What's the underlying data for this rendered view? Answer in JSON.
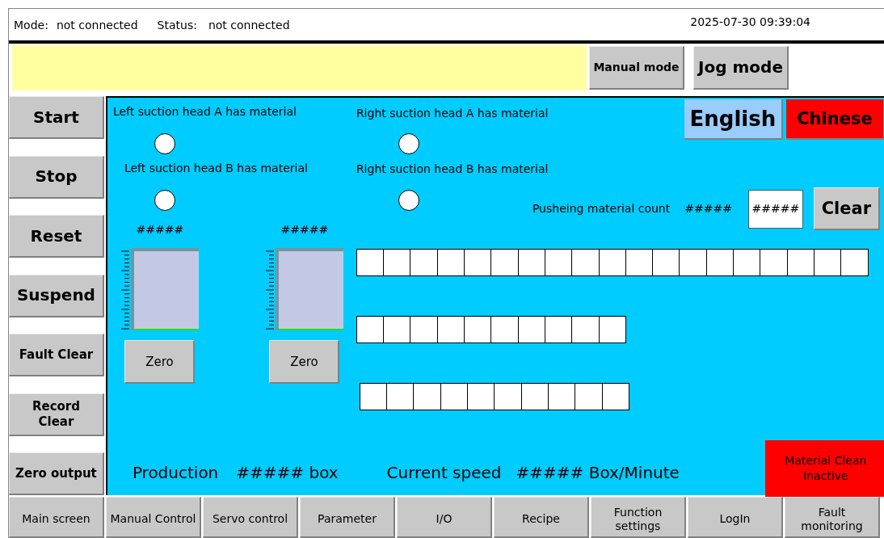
{
  "status_bar": {
    "mode_label": "Mode:",
    "mode_value": "not connected",
    "status_label": "Status:",
    "status_value": "not connected",
    "datetime": "2025-07-30 09:39:04"
  },
  "mode_buttons": [
    "Manual mode",
    "Jog mode"
  ],
  "side_buttons": [
    "Start",
    "Stop",
    "Reset",
    "Suspend",
    "Fault Clear",
    "Record\nClear",
    "Zero output"
  ],
  "lamps": [
    {
      "label": "Left suction head A has material",
      "on": false
    },
    {
      "label": "Left suction head B has material",
      "on": false
    },
    {
      "label": "Right suction head A has material",
      "on": false
    },
    {
      "label": "Right suction head B has material",
      "on": false
    }
  ],
  "language_buttons": [
    {
      "label": "English",
      "color": "#99ccff"
    },
    {
      "label": "Chinese",
      "color": "#ff0000"
    }
  ],
  "push_count": {
    "label": "Pusheing material count",
    "value": "#####",
    "input": "#####",
    "button": "Clear"
  },
  "gauges": [
    {
      "reading": "#####",
      "level": 0,
      "button": "Zero"
    },
    {
      "reading": "#####",
      "level": 0,
      "button": "Zero"
    }
  ],
  "slot_rows": [
    {
      "slots": [
        {
          "filled": false
        },
        {
          "filled": false
        },
        {
          "filled": false
        },
        {
          "filled": false
        },
        {
          "filled": false
        },
        {
          "filled": false
        },
        {
          "filled": false
        },
        {
          "filled": false
        },
        {
          "filled": false
        },
        {
          "filled": false
        },
        {
          "filled": false
        },
        {
          "filled": false
        },
        {
          "filled": false
        },
        {
          "filled": false
        },
        {
          "filled": false
        },
        {
          "filled": false
        },
        {
          "filled": false
        },
        {
          "filled": false
        },
        {
          "filled": false
        }
      ]
    },
    {
      "slots": [
        {
          "filled": false
        },
        {
          "filled": false
        },
        {
          "filled": false
        },
        {
          "filled": false
        },
        {
          "filled": false
        },
        {
          "filled": false
        },
        {
          "filled": false
        },
        {
          "filled": false
        },
        {
          "filled": false
        },
        {
          "filled": false
        }
      ]
    },
    {
      "slots": [
        {
          "filled": false
        },
        {
          "filled": false
        },
        {
          "filled": false
        },
        {
          "filled": false
        },
        {
          "filled": false
        },
        {
          "filled": false
        },
        {
          "filled": false
        },
        {
          "filled": false
        },
        {
          "filled": false
        },
        {
          "filled": false
        }
      ]
    }
  ],
  "production": {
    "label": "Production",
    "value": "##### box"
  },
  "speed": {
    "label": "Current speed",
    "value": "##### Box/Minute"
  },
  "material_clean": {
    "text": "Material Clean\nInactive",
    "active": false
  },
  "nav_buttons": [
    "Main screen",
    "Manual Control",
    "Servo control",
    "Parameter",
    "I/O",
    "Recipe",
    "Function\nsettings",
    "LogIn",
    "Fault\nmonitoring"
  ]
}
